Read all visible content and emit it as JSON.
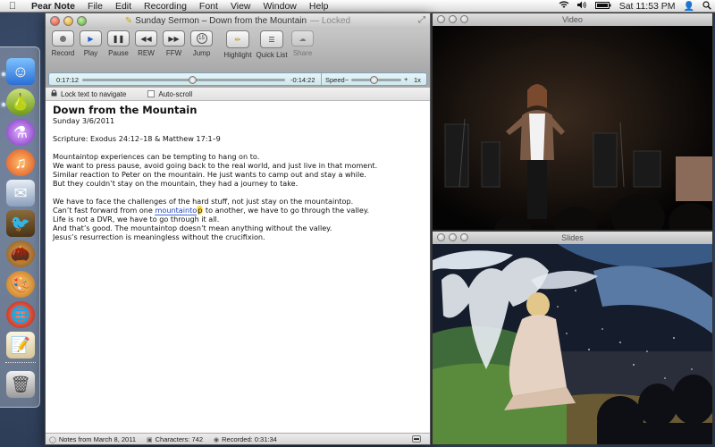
{
  "menubar": {
    "app_name": "Pear Note",
    "items": [
      "File",
      "Edit",
      "Recording",
      "Font",
      "View",
      "Window",
      "Help"
    ],
    "clock": "Sat 11:53 PM"
  },
  "main_window": {
    "title": "Sunday Sermon – Down from the Mountain",
    "title_status": "— Locked",
    "toolbar": {
      "record": "Record",
      "play": "Play",
      "pause": "Pause",
      "rew": "REW",
      "ffw": "FFW",
      "jump": "Jump",
      "jump_value": "15",
      "highlight": "Highlight",
      "quick_list": "Quick List",
      "share": "Share"
    },
    "transport": {
      "elapsed": "0:17:12",
      "remaining": "-0:14:22",
      "speed_label": "Speed",
      "speed_minus": "–",
      "speed_plus": "+",
      "speed_value": "1x",
      "progress_fraction": 0.545,
      "speed_fraction": 0.45
    },
    "options": {
      "lock_label": "Lock text to navigate",
      "autoscroll_label": "Auto-scroll"
    },
    "document": {
      "heading": "Down from the Mountain",
      "date": "Sunday 3/6/2011",
      "scripture": "Scripture: Exodus 24:12–18 & Matthew 17:1–9",
      "p1": [
        "Mountaintop experiences can be tempting to hang on to.",
        "We want to press pause, avoid going back to the real world, and just live in that moment.",
        "Similar reaction to Peter on the mountain. He just wants to camp out and stay a while.",
        "But they couldn’t stay on the mountain, they had a journey to take."
      ],
      "p2_line1": "We have to face the challenges of the hard stuff, not just stay on the mountaintop.",
      "p2_line2_pre": "Can’t fast forward from one ",
      "p2_line2_link": "mountainto",
      "p2_line2_mark": "p",
      "p2_line2_post": " to another, we have to go through the valley.",
      "p2_rest": [
        "Life is not a DVR, we have to go through it all.",
        "And that’s good. The mountaintop doesn’t mean anything without the valley.",
        "Jesus’s resurrection is meaningless without the crucifixion."
      ]
    },
    "status": {
      "notes_from": "Notes from March 8, 2011",
      "characters": "Characters: 742",
      "recorded": "Recorded: 0:31:34"
    }
  },
  "video_window": {
    "title": "Video"
  },
  "slides_window": {
    "title": "Slides"
  },
  "colors": {
    "menubar": "#e6e6e6",
    "transport": "#d9eef2",
    "highlight_mark": "#ffd84a",
    "link": "#1a3fbf"
  }
}
